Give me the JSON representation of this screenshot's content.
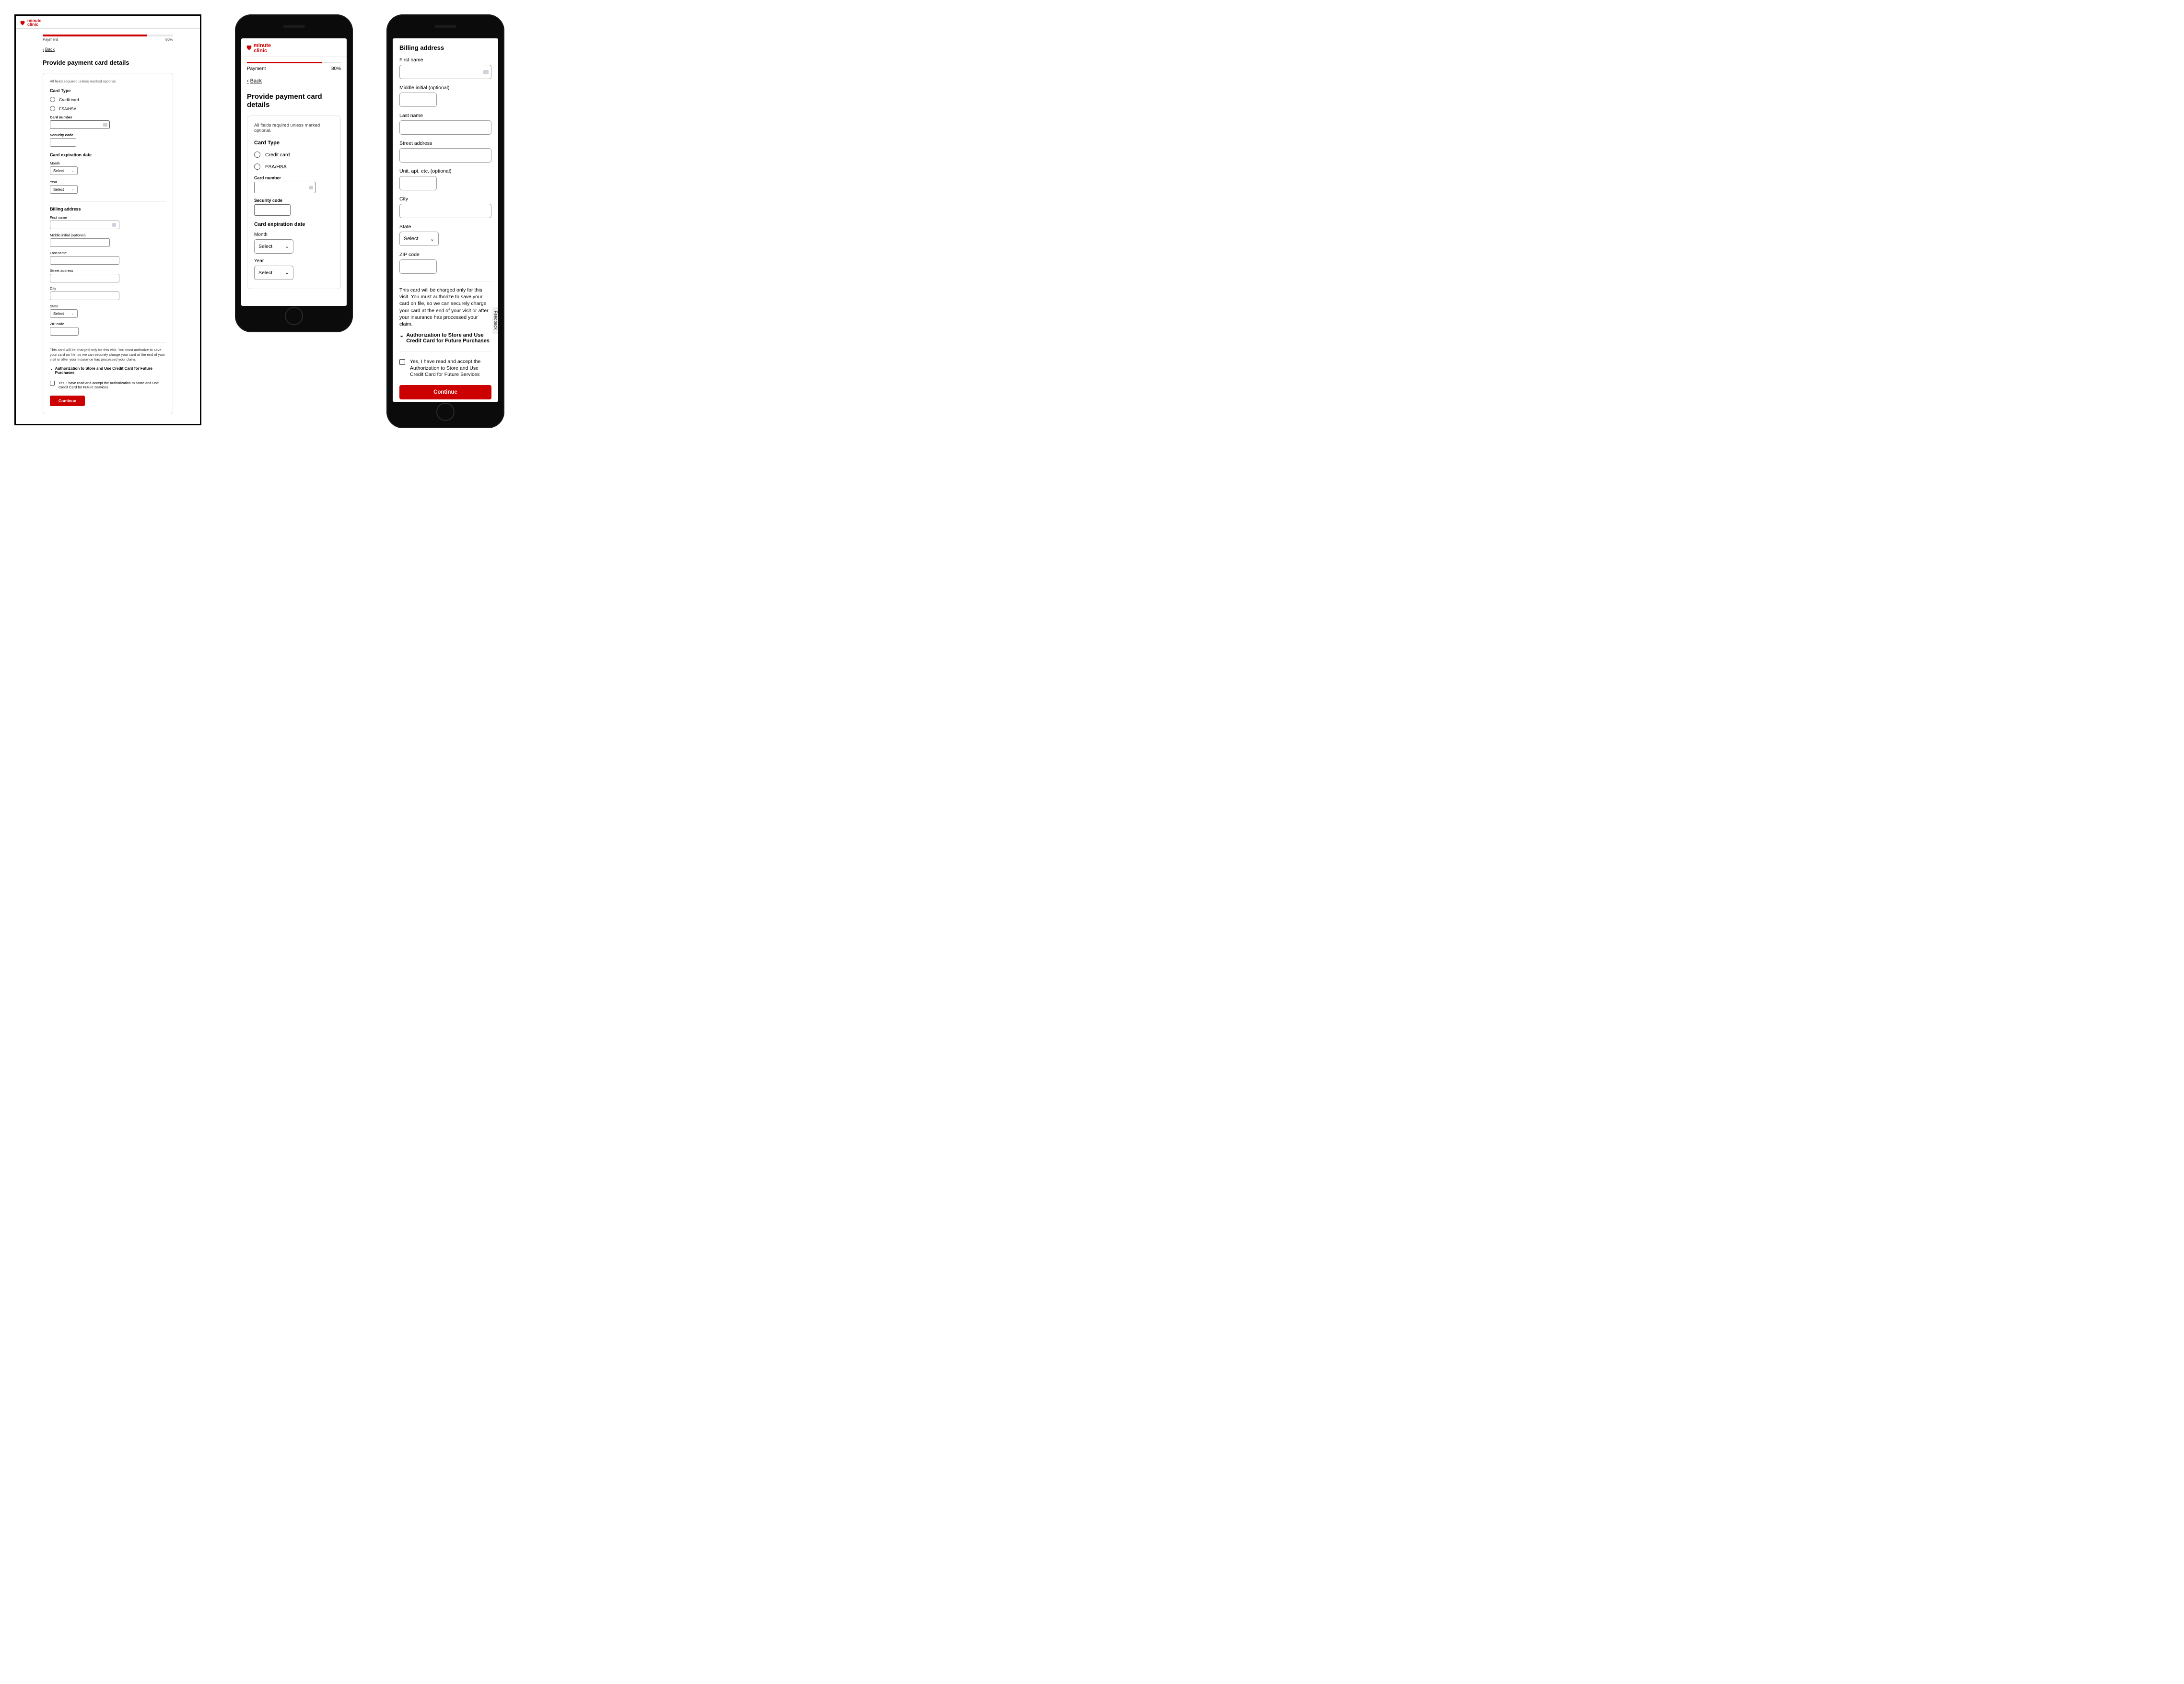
{
  "brand": {
    "line1": "minute",
    "line2": "clinic"
  },
  "progress": {
    "label": "Payment",
    "percent": "80%",
    "fill": 80
  },
  "back": "Back",
  "pageTitle": "Provide payment card details",
  "note": "All fields required unless marked optional.",
  "cardType": {
    "heading": "Card Type",
    "credit": "Credit card",
    "fsa": "FSA/HSA"
  },
  "fields": {
    "cardNumber": "Card number",
    "securityCode": "Security code",
    "expHeading": "Card expiration date",
    "month": "Month",
    "year": "Year",
    "select": "Select"
  },
  "billing": {
    "heading": "Billing address",
    "firstName": "First name",
    "middle": "Middle initial (optional)",
    "lastName": "Last name",
    "street": "Street address",
    "unit": "Unit, apt, etc. (optional)",
    "city": "City",
    "state": "State",
    "zip": "ZIP code"
  },
  "disclaimer": "This card will be charged only for this visit. You must authorize to save your card on file, so we can securely charge your card at the end of your visit or after your insurance has processed your claim.",
  "accordion": "Authorization to Store and Use Credit Card for Future Purchases",
  "consent": "Yes, I have read and accept the Authorization to Store and Use Credit Card for Future Services",
  "continue": "Continue",
  "feedback": "Feedback"
}
